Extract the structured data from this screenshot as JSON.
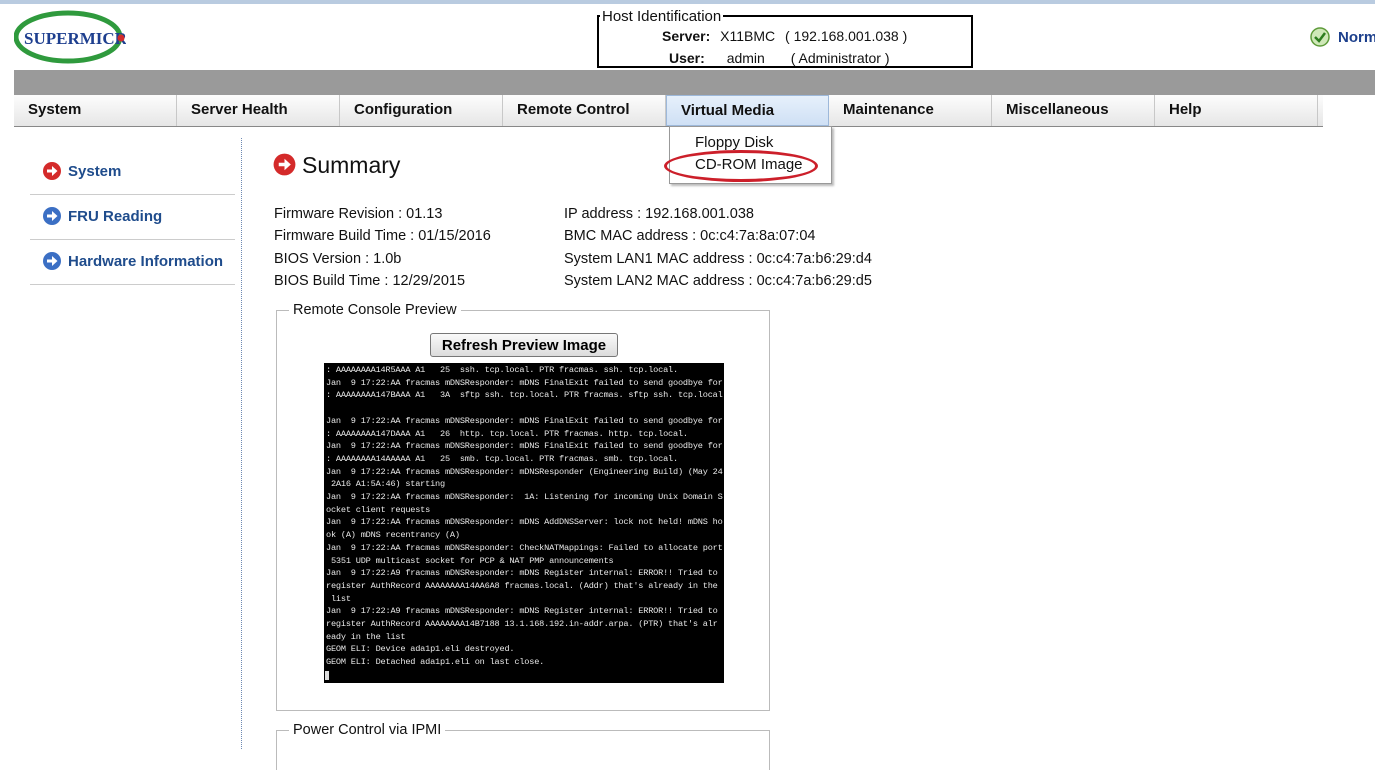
{
  "logo": {
    "text": "SUPERMICR"
  },
  "host": {
    "title": "Host Identification",
    "server_label": "Server:",
    "server_value": "X11BMC",
    "server_ip": "( 192.168.001.038 )",
    "user_label": "User:",
    "user_value": "admin",
    "user_role": "( Administrator )"
  },
  "status": {
    "text": "Norm"
  },
  "menu": [
    {
      "label": "System"
    },
    {
      "label": "Server Health"
    },
    {
      "label": "Configuration"
    },
    {
      "label": "Remote Control"
    },
    {
      "label": "Virtual Media"
    },
    {
      "label": "Maintenance"
    },
    {
      "label": "Miscellaneous"
    },
    {
      "label": "Help"
    }
  ],
  "dropdown": {
    "items": [
      "Floppy Disk",
      "CD-ROM Image"
    ]
  },
  "sidebar": {
    "items": [
      {
        "label": "System",
        "color": "#d42a2a"
      },
      {
        "label": "FRU Reading",
        "color": "#3b6fc4"
      },
      {
        "label": "Hardware Information",
        "color": "#3b6fc4"
      }
    ]
  },
  "summary": {
    "title": "Summary",
    "left": [
      "Firmware Revision : 01.13",
      "Firmware Build Time : 01/15/2016",
      "BIOS Version : 1.0b",
      "BIOS Build Time : 12/29/2015"
    ],
    "right": [
      "IP address : 192.168.001.038",
      "BMC MAC address : 0c:c4:7a:8a:07:04",
      "System LAN1 MAC address : 0c:c4:7a:b6:29:d4",
      "System LAN2 MAC address : 0c:c4:7a:b6:29:d5"
    ]
  },
  "preview": {
    "legend": "Remote Console Preview",
    "button": "Refresh Preview Image",
    "console_lines": [
      ": AAAAAAAA14R5AAA A1   25  ssh. tcp.local. PTR fracmas. ssh. tcp.local.",
      "Jan  9 17:22:AA fracmas mDNSResponder: mDNS FinalExit failed to send goodbye for",
      ": AAAAAAAA147BAAA A1   3A  sftp ssh. tcp.local. PTR fracmas. sftp ssh. tcp.local",
      "",
      "Jan  9 17:22:AA fracmas mDNSResponder: mDNS FinalExit failed to send goodbye for",
      ": AAAAAAAA147DAAA A1   26  http. tcp.local. PTR fracmas. http. tcp.local.",
      "Jan  9 17:22:AA fracmas mDNSResponder: mDNS FinalExit failed to send goodbye for",
      ": AAAAAAAA14AAAAA A1   25  smb. tcp.local. PTR fracmas. smb. tcp.local.",
      "Jan  9 17:22:AA fracmas mDNSResponder: mDNSResponder (Engineering Build) (May 24",
      " 2A16 A1:5A:46) starting",
      "Jan  9 17:22:AA fracmas mDNSResponder:  1A: Listening for incoming Unix Domain S",
      "ocket client requests",
      "Jan  9 17:22:AA fracmas mDNSResponder: mDNS AddDNSServer: lock not held! mDNS ho",
      "ok (A) mDNS recentrancy (A)",
      "Jan  9 17:22:AA fracmas mDNSResponder: CheckNATMappings: Failed to allocate port",
      " 5351 UDP multicast socket for PCP & NAT PMP announcements",
      "Jan  9 17:22:A9 fracmas mDNSResponder: mDNS Register internal: ERROR!! Tried to",
      "register AuthRecord AAAAAAAA14AA6A8 fracmas.local. (Addr) that's already in the",
      " list",
      "Jan  9 17:22:A9 fracmas mDNSResponder: mDNS Register internal: ERROR!! Tried to",
      "register AuthRecord AAAAAAAA14B7188 13.1.168.192.in-addr.arpa. (PTR) that's alr",
      "eady in the list",
      "GEOM ELI: Device ada1p1.eli destroyed.",
      "GEOM ELI: Detached ada1p1.eli on last close."
    ]
  },
  "power": {
    "legend": "Power Control via IPMI"
  }
}
